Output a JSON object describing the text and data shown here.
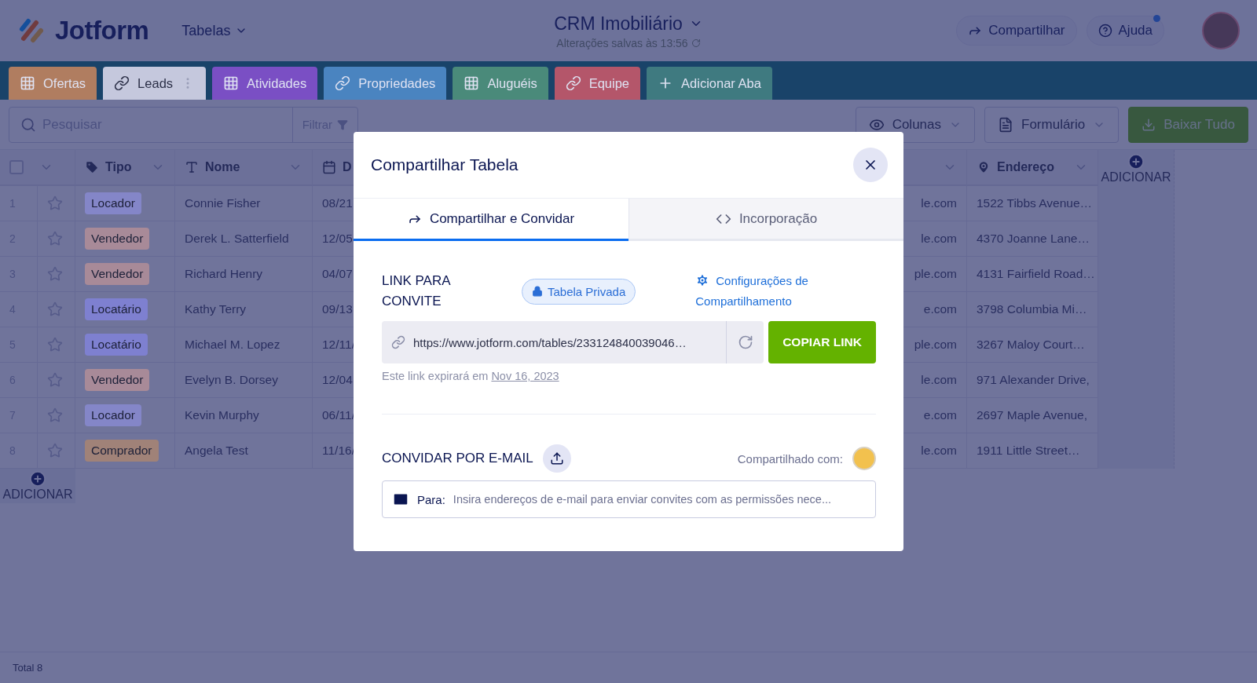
{
  "header": {
    "logo": "Jotform",
    "menu": "Tabelas",
    "title": "CRM Imobiliário",
    "save_status": "Alterações salvas às 13:56",
    "actions": [
      {
        "label": "Compartilhar",
        "kind": "share",
        "notification": false
      },
      {
        "label": "Ajuda",
        "kind": "help",
        "notification": true
      }
    ]
  },
  "tabs": [
    {
      "label": "Ofertas",
      "kind": "table",
      "color": "#b07d60",
      "selected": false
    },
    {
      "label": "Leads",
      "kind": "link",
      "color": "#c5c8dd",
      "selected": true
    },
    {
      "label": "Atividades",
      "kind": "table",
      "color": "#7a4fc4",
      "selected": false
    },
    {
      "label": "Propriedades",
      "kind": "link",
      "color": "#4a84c0",
      "selected": false
    },
    {
      "label": "Aluguéis",
      "kind": "table",
      "color": "#4a8a7a",
      "selected": false
    },
    {
      "label": "Equipe",
      "kind": "link",
      "color": "#b4566a",
      "selected": false
    },
    {
      "label": "Adicionar Aba",
      "kind": "add",
      "color": "#3f7a80",
      "selected": false
    }
  ],
  "toolbar": {
    "search_placeholder": "Pesquisar",
    "filter": "Filtrar",
    "buttons": [
      {
        "label": "Colunas",
        "kind": "columns"
      },
      {
        "label": "Formulário",
        "kind": "form"
      },
      {
        "label": "Baixar Tudo",
        "kind": "download"
      }
    ]
  },
  "table": {
    "select_all": {
      "checked": false
    },
    "columns": [
      {
        "label": "Tipo",
        "kind": "tag"
      },
      {
        "label": "Nome",
        "kind": "text"
      },
      {
        "label": "D",
        "kind": "date"
      },
      {
        "kind": "email"
      },
      {
        "label": "Endereço",
        "kind": "address"
      }
    ],
    "add_column": "ADICIONAR",
    "rows": [
      {
        "number": "1",
        "starred": false,
        "color": "#8486c8",
        "cells": [
          "Locador",
          "Connie Fisher",
          "08/21",
          "le.com",
          "1522 Tibbs Avenue…"
        ]
      },
      {
        "number": "2",
        "starred": false,
        "color": "#a88a98",
        "cells": [
          "Vendedor",
          "Derek L. Satterfield",
          "12/05",
          "le.com",
          "4370 Joanne Lane…"
        ]
      },
      {
        "number": "3",
        "starred": false,
        "color": "#a88a98",
        "cells": [
          "Vendedor",
          "Richard Henry",
          "04/07",
          "ple.com",
          "4131 Fairfield Road…"
        ]
      },
      {
        "number": "4",
        "starred": false,
        "color": "#7e80d0",
        "cells": [
          "Locatário",
          "Kathy Terry",
          "09/13",
          "e.com",
          "3798 Columbia Mi…"
        ]
      },
      {
        "number": "5",
        "starred": false,
        "color": "#7e80d0",
        "cells": [
          "Locatário",
          "Michael M. Lopez",
          "12/11/",
          "ple.com",
          "3267 Maloy Court…"
        ]
      },
      {
        "number": "6",
        "starred": false,
        "color": "#a88a98",
        "cells": [
          "Vendedor",
          "Evelyn B. Dorsey",
          "12/04",
          "le.com",
          "971 Alexander Drive,"
        ]
      },
      {
        "number": "7",
        "starred": false,
        "color": "#8486c8",
        "cells": [
          "Locador",
          "Kevin Murphy",
          "06/11/",
          "e.com",
          "2697 Maple Avenue,"
        ]
      },
      {
        "number": "8",
        "starred": false,
        "color": "#a08278",
        "cells": [
          "Comprador",
          "Angela Test",
          "11/16/",
          "le.com",
          "1911 Little Street…"
        ]
      }
    ],
    "add_row": "ADICIONAR"
  },
  "footer": {
    "total": "Total 8"
  },
  "modal": {
    "title": "Compartilhar Tabela",
    "tabs": [
      {
        "label": "Compartilhar e Convidar",
        "kind": "share",
        "selected": true
      },
      {
        "label": "Incorporação",
        "kind": "embed",
        "selected": false
      }
    ],
    "link_section": {
      "heading": "LINK PARA CONVITE",
      "privacy_badge": "Tabela Privada",
      "settings_link": "Configurações de Compartilhamento",
      "url": "https://www.jotform.com/tables/233124840039046…",
      "copy_button": "COPIAR LINK",
      "expiry_text": "Este link expirará em",
      "expiry_date": "Nov 16, 2023"
    },
    "invite_section": {
      "heading": "CONVIDAR POR E-MAIL",
      "shared_with": "Compartilhado com:",
      "to_label": "Para:",
      "placeholder": "Insira endereços de e-mail para enviar convites com as permissões nece..."
    }
  }
}
